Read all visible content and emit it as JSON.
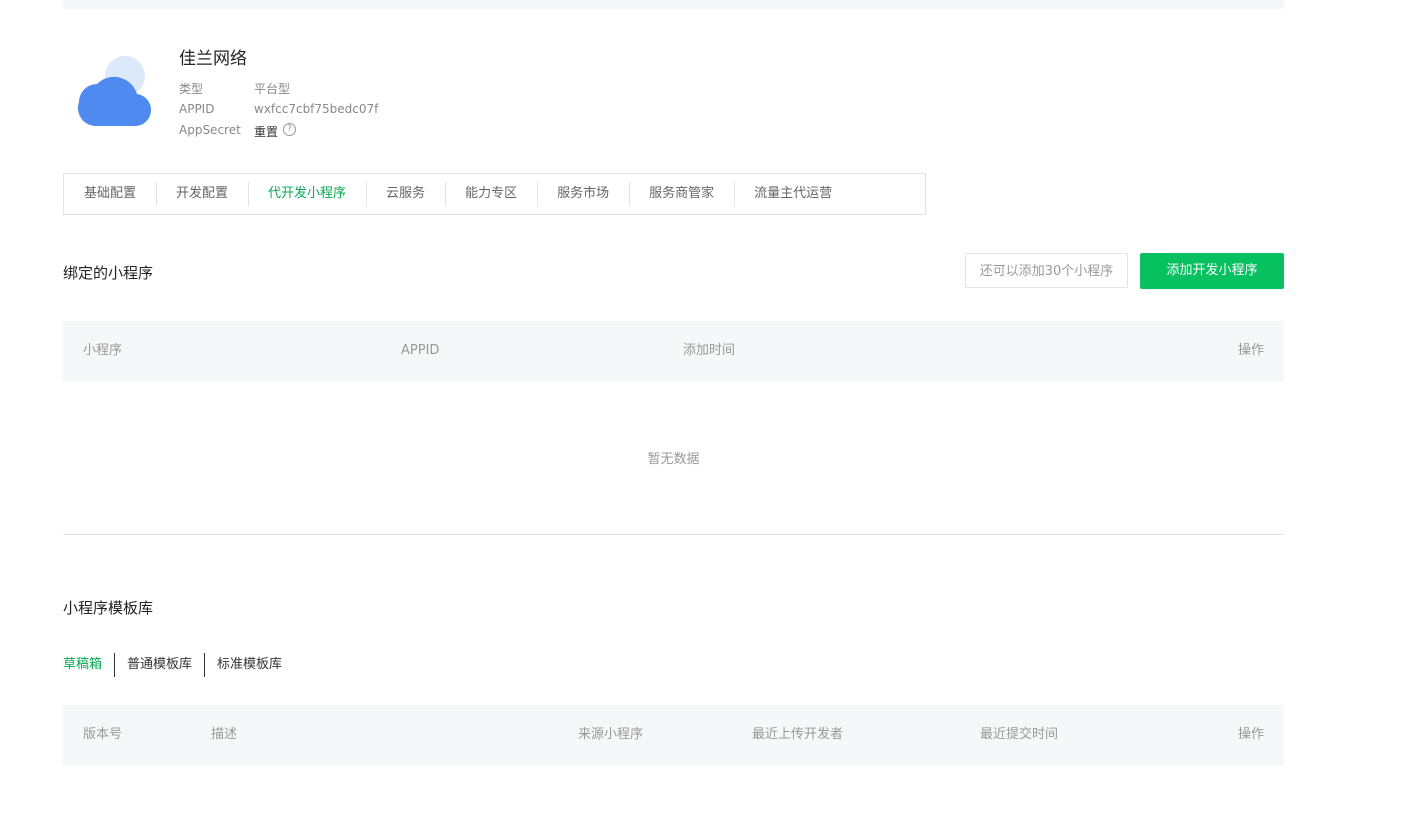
{
  "app": {
    "name": "佳兰网络",
    "type_label": "类型",
    "type_value": "平台型",
    "appid_label": "APPID",
    "appid_value": "wxfcc7cbf75bedc07f",
    "secret_label": "AppSecret",
    "secret_action": "重置",
    "help_glyph": "?"
  },
  "tabs": [
    {
      "label": "基础配置"
    },
    {
      "label": "开发配置"
    },
    {
      "label": "代开发小程序",
      "active": true
    },
    {
      "label": "云服务"
    },
    {
      "label": "能力专区"
    },
    {
      "label": "服务市场"
    },
    {
      "label": "服务商管家"
    },
    {
      "label": "流量主代运营"
    }
  ],
  "bound": {
    "title": "绑定的小程序",
    "quota_text": "还可以添加30个小程序",
    "add_button": "添加开发小程序",
    "columns": [
      "小程序",
      "APPID",
      "添加时间",
      "操作"
    ],
    "empty_text": "暂无数据"
  },
  "templates": {
    "title": "小程序模板库",
    "subtabs": [
      {
        "label": "草稿箱",
        "active": true
      },
      {
        "label": "普通模板库"
      },
      {
        "label": "标准模板库"
      }
    ],
    "columns": [
      "版本号",
      "描述",
      "来源小程序",
      "最近上传开发者",
      "最近提交时间",
      "操作"
    ]
  },
  "colors": {
    "accent": "#07c160",
    "active_text": "#07a854",
    "header_bg": "#f6f7f9"
  }
}
